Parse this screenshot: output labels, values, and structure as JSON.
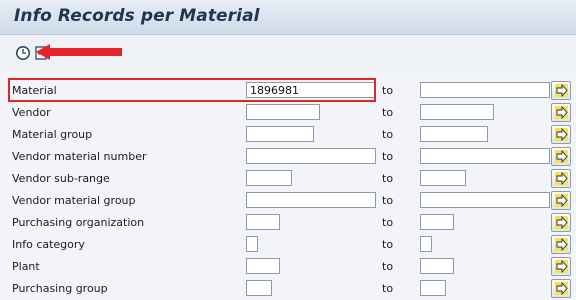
{
  "window": {
    "title": "Info Records per Material"
  },
  "toolbar": {
    "execute": {
      "icon": "execute-clock-icon"
    },
    "variant": {
      "icon": "get-variant-icon"
    },
    "annotation": {
      "icon": "red-arrow-icon",
      "color": "#e3242b"
    }
  },
  "selection": {
    "to_label": "to",
    "more_icon": "multiple-selection-arrow-icon",
    "highlight_color": "#e3242b",
    "rows": [
      {
        "label": "Material",
        "low": "1896981",
        "high": ""
      },
      {
        "label": "Vendor",
        "low": "",
        "high": ""
      },
      {
        "label": "Material group",
        "low": "",
        "high": ""
      },
      {
        "label": "Vendor material number",
        "low": "",
        "high": ""
      },
      {
        "label": "Vendor sub-range",
        "low": "",
        "high": ""
      },
      {
        "label": "Vendor material group",
        "low": "",
        "high": ""
      },
      {
        "label": "Purchasing organization",
        "low": "",
        "high": ""
      },
      {
        "label": "Info category",
        "low": "",
        "high": ""
      },
      {
        "label": "Plant",
        "low": "",
        "high": ""
      },
      {
        "label": "Purchasing group",
        "low": "",
        "high": ""
      }
    ]
  }
}
